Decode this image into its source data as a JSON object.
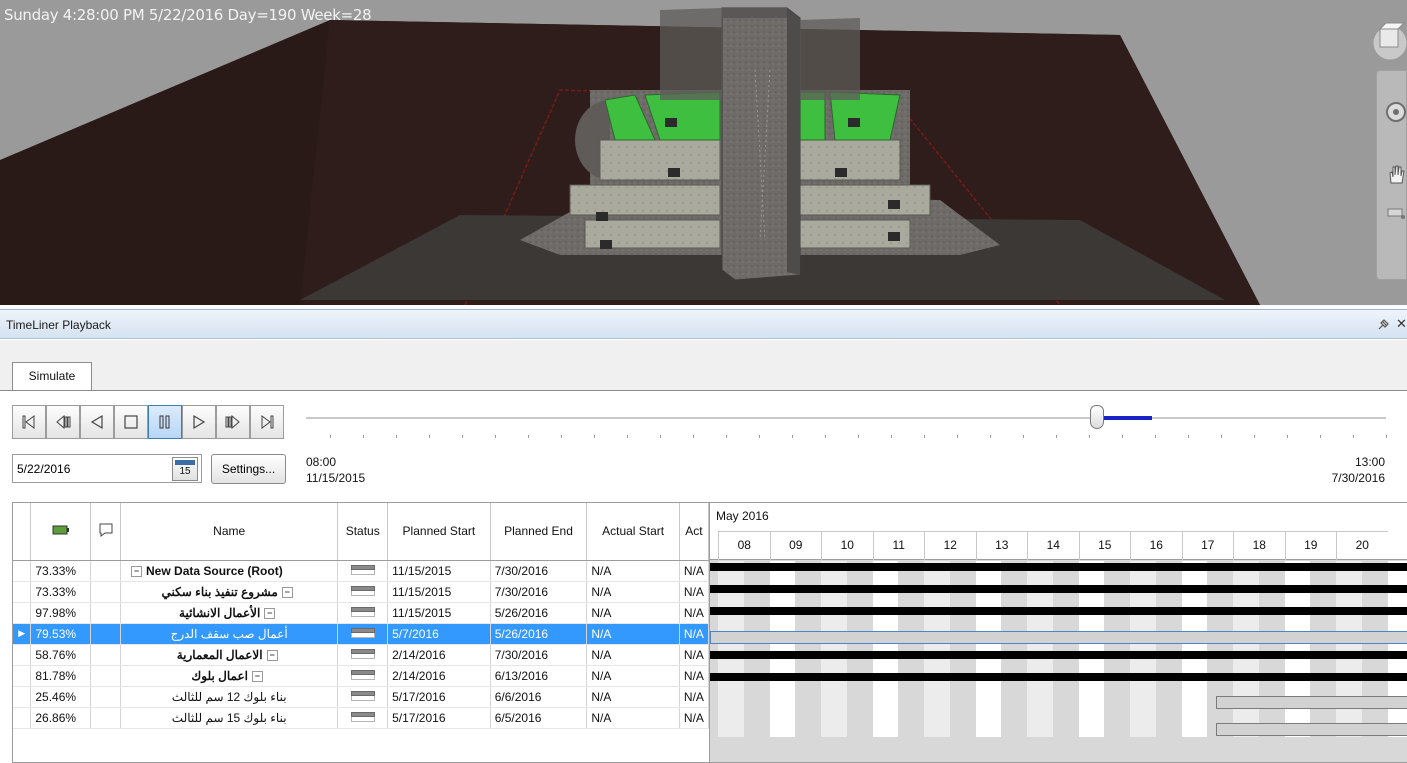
{
  "viewport": {
    "status_text": "Sunday 4:28:00 PM 5/22/2016 Day=190 Week=28",
    "nav_tools": [
      "nav-cube-icon",
      "steering-wheel-icon",
      "pan-hand-icon",
      "zoom-icon"
    ]
  },
  "panel": {
    "title": "TimeLiner Playback",
    "tabs": [
      {
        "label": "Simulate"
      }
    ]
  },
  "playback": {
    "buttons": [
      {
        "name": "rewind-to-start",
        "icon": "skip-to-start-icon"
      },
      {
        "name": "step-back",
        "icon": "step-back-icon"
      },
      {
        "name": "play-reverse",
        "icon": "play-reverse-icon"
      },
      {
        "name": "stop",
        "icon": "stop-icon"
      },
      {
        "name": "pause",
        "icon": "pause-icon",
        "active": true
      },
      {
        "name": "play",
        "icon": "play-icon"
      },
      {
        "name": "step-forward",
        "icon": "step-forward-icon"
      },
      {
        "name": "forward-to-end",
        "icon": "skip-to-end-icon"
      }
    ],
    "slider_position": 0.73,
    "current_date": "5/22/2016",
    "calendar_day": "15",
    "settings_label": "Settings...",
    "range_start_time": "08:00",
    "range_start_date": "11/15/2015",
    "range_end_time": "13:00",
    "range_end_date": "7/30/2016"
  },
  "grid": {
    "columns": [
      "",
      "",
      "Name",
      "Status",
      "Planned Start",
      "Planned End",
      "Actual Start",
      "Act"
    ],
    "rows": [
      {
        "progress": "73.33%",
        "name": "New Data Source (Root)",
        "bold": true,
        "planned_start": "11/15/2015",
        "planned_end": "7/30/2016",
        "actual_start": "N/A",
        "actual_end": "N/A"
      },
      {
        "progress": "73.33%",
        "name": "مشروع تنفيذ بناء سكني",
        "bold": true,
        "planned_start": "11/15/2015",
        "planned_end": "7/30/2016",
        "actual_start": "N/A",
        "actual_end": "N/A"
      },
      {
        "progress": "97.98%",
        "name": "الأعمال الانشائية",
        "bold": true,
        "planned_start": "11/15/2015",
        "planned_end": "5/26/2016",
        "actual_start": "N/A",
        "actual_end": "N/A"
      },
      {
        "progress": "79.53%",
        "name": "أعمال صب سقف الدرج",
        "bold": false,
        "selected": true,
        "planned_start": "5/7/2016",
        "planned_end": "5/26/2016",
        "actual_start": "N/A",
        "actual_end": "N/A"
      },
      {
        "progress": "58.76%",
        "name": "الاعمال المعمارية",
        "bold": true,
        "planned_start": "2/14/2016",
        "planned_end": "7/30/2016",
        "actual_start": "N/A",
        "actual_end": "N/A"
      },
      {
        "progress": "81.78%",
        "name": "اعمال بلوك",
        "bold": true,
        "planned_start": "2/14/2016",
        "planned_end": "6/13/2016",
        "actual_start": "N/A",
        "actual_end": "N/A"
      },
      {
        "progress": "25.46%",
        "name": "بناء بلوك 12 سم للثالث",
        "bold": false,
        "planned_start": "5/17/2016",
        "planned_end": "6/6/2016",
        "actual_start": "N/A",
        "actual_end": "N/A"
      },
      {
        "progress": "26.86%",
        "name": "بناء بلوك 15 سم للثالث",
        "bold": false,
        "planned_start": "5/17/2016",
        "planned_end": "6/5/2016",
        "actual_start": "N/A",
        "actual_end": "N/A"
      }
    ]
  },
  "gantt": {
    "month_label": "May 2016",
    "days": [
      "08",
      "09",
      "10",
      "11",
      "12",
      "13",
      "14",
      "15",
      "16",
      "17",
      "18",
      "19",
      "20"
    ]
  }
}
